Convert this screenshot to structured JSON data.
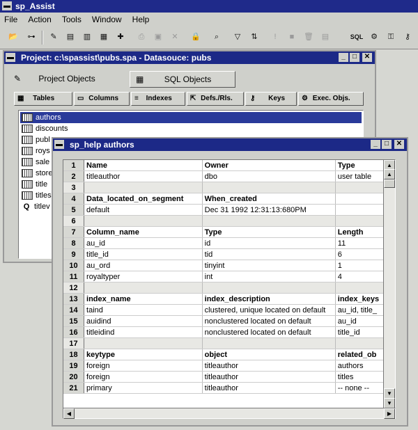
{
  "app": {
    "title": "sp_Assist"
  },
  "menu": [
    "File",
    "Action",
    "Tools",
    "Window",
    "Help"
  ],
  "toolbar": {
    "sql_label": "SQL"
  },
  "project_window": {
    "title": "Project: c:\\spassist\\pubs.spa - Datasouce: pubs",
    "tabs": [
      "Project Objects",
      "SQL Objects"
    ],
    "subtabs": [
      "Tables",
      "Columns",
      "Indexes",
      "Defs./Rls.",
      "Keys",
      "Exec. Objs."
    ],
    "items": [
      "authors",
      "discounts",
      "publ",
      "roys",
      "sale",
      "store",
      "title",
      "titles",
      "titlev"
    ]
  },
  "help_window": {
    "title": "sp_help authors",
    "rows": [
      [
        "1",
        "Name",
        "Owner",
        "Type"
      ],
      [
        "2",
        "titleauthor",
        "dbo",
        "user table"
      ],
      [
        "3",
        "",
        "",
        ""
      ],
      [
        "4",
        "Data_located_on_segment",
        "When_created",
        ""
      ],
      [
        "5",
        "default",
        "Dec 31 1992 12:31:13:680PM",
        ""
      ],
      [
        "6",
        "",
        "",
        ""
      ],
      [
        "7",
        "Column_name",
        "Type",
        "Length"
      ],
      [
        "8",
        "au_id",
        "id",
        "11"
      ],
      [
        "9",
        "title_id",
        "tid",
        "6"
      ],
      [
        "10",
        "au_ord",
        "tinyint",
        "1"
      ],
      [
        "11",
        "royaltyper",
        "int",
        "4"
      ],
      [
        "12",
        "",
        "",
        ""
      ],
      [
        "13",
        "index_name",
        "index_description",
        "index_keys"
      ],
      [
        "14",
        "taind",
        "clustered, unique located on default",
        "au_id, title_"
      ],
      [
        "15",
        "auidind",
        "nonclustered located on default",
        "au_id"
      ],
      [
        "16",
        "titleidind",
        "nonclustered located on default",
        "title_id"
      ],
      [
        "17",
        "",
        "",
        ""
      ],
      [
        "18",
        "keytype",
        "object",
        "related_ob"
      ],
      [
        "19",
        "foreign",
        "titleauthor",
        "authors"
      ],
      [
        "20",
        "foreign",
        "titleauthor",
        "titles"
      ],
      [
        "21",
        "primary",
        "titleauthor",
        "-- none --"
      ]
    ],
    "header_rows": [
      "1",
      "4",
      "7",
      "13",
      "18"
    ]
  }
}
